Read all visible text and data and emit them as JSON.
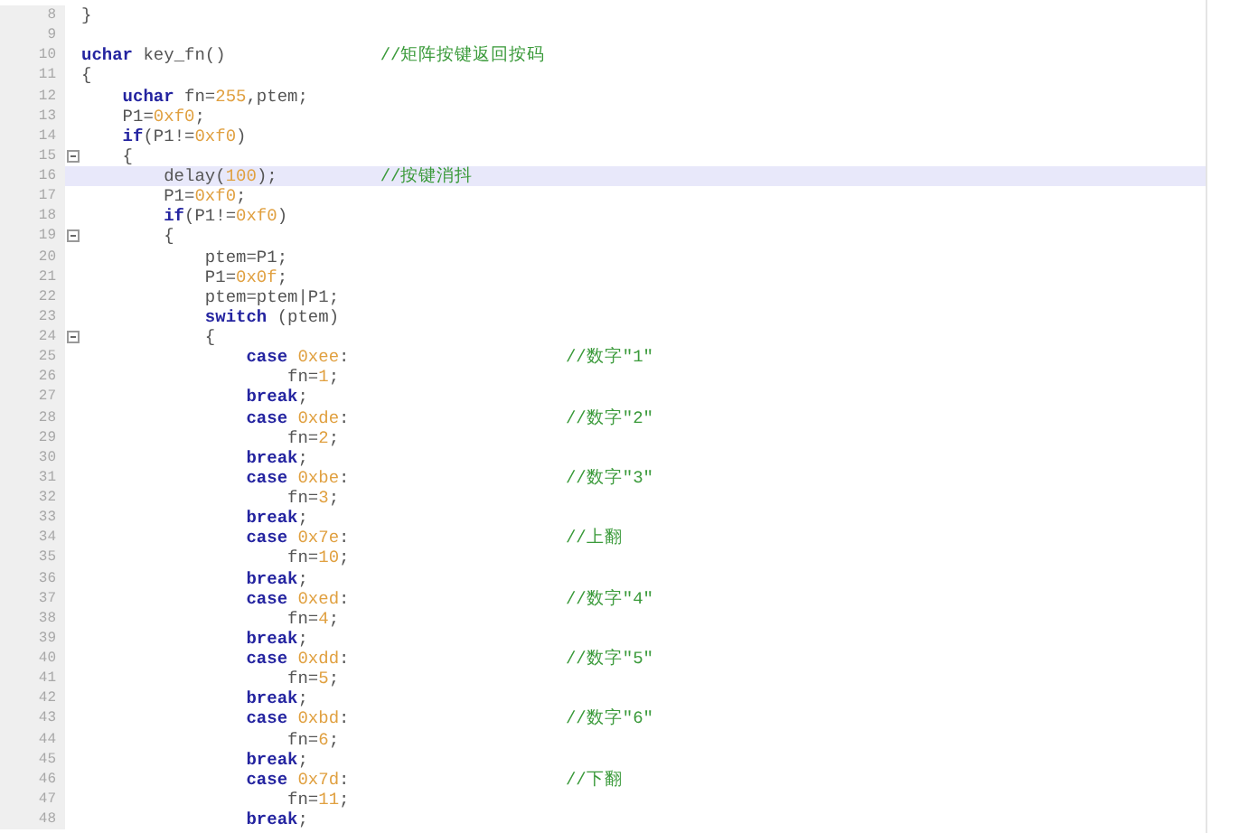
{
  "editor": {
    "lines": [
      {
        "number": "8",
        "tokens": [
          {
            "kind": "plain",
            "text": "}"
          }
        ]
      },
      {
        "number": "9"
      },
      {
        "number": "10",
        "tokens": [
          {
            "kind": "keyword",
            "text": "uchar"
          },
          {
            "kind": "plain",
            "text": " key_fn()"
          }
        ],
        "comment": {
          "kind": "inline",
          "text": "//矩阵按键返回按码"
        }
      },
      {
        "number": "11",
        "tokens": [
          {
            "kind": "plain",
            "text": "{"
          }
        ]
      },
      {
        "number": "12",
        "tokens": [
          {
            "kind": "keyword",
            "text": "    uchar"
          },
          {
            "kind": "plain",
            "text": " fn="
          },
          {
            "kind": "number",
            "text": "255"
          },
          {
            "kind": "plain",
            "text": ",ptem;"
          }
        ]
      },
      {
        "number": "13",
        "tokens": [
          {
            "kind": "plain",
            "text": "    P1="
          },
          {
            "kind": "number",
            "text": "0xf0"
          },
          {
            "kind": "plain",
            "text": ";"
          }
        ]
      },
      {
        "number": "14",
        "tokens": [
          {
            "kind": "keyword",
            "text": "    if"
          },
          {
            "kind": "plain",
            "text": "(P1!="
          },
          {
            "kind": "number",
            "text": "0xf0"
          },
          {
            "kind": "plain",
            "text": ")"
          }
        ]
      },
      {
        "number": "15",
        "fold": true,
        "tokens": [
          {
            "kind": "plain",
            "text": "    {"
          }
        ]
      },
      {
        "number": "16",
        "highlighted": true,
        "tokens": [
          {
            "kind": "plain",
            "text": "        delay("
          },
          {
            "kind": "number",
            "text": "100"
          },
          {
            "kind": "plain",
            "text": ");"
          }
        ],
        "comment": {
          "kind": "inline",
          "text": "//按键消抖"
        }
      },
      {
        "number": "17",
        "tokens": [
          {
            "kind": "plain",
            "text": "        P1="
          },
          {
            "kind": "number",
            "text": "0xf0"
          },
          {
            "kind": "plain",
            "text": ";"
          }
        ]
      },
      {
        "number": "18",
        "tokens": [
          {
            "kind": "keyword",
            "text": "        if"
          },
          {
            "kind": "plain",
            "text": "(P1!="
          },
          {
            "kind": "number",
            "text": "0xf0"
          },
          {
            "kind": "plain",
            "text": ")"
          }
        ]
      },
      {
        "number": "19",
        "fold": true,
        "tokens": [
          {
            "kind": "plain",
            "text": "        {"
          }
        ]
      },
      {
        "number": "20",
        "tokens": [
          {
            "kind": "plain",
            "text": "            ptem=P1;"
          }
        ]
      },
      {
        "number": "21",
        "tokens": [
          {
            "kind": "plain",
            "text": "            P1="
          },
          {
            "kind": "number",
            "text": "0x0f"
          },
          {
            "kind": "plain",
            "text": ";"
          }
        ]
      },
      {
        "number": "22",
        "tokens": [
          {
            "kind": "plain",
            "text": "            ptem=ptem|P1;"
          }
        ]
      },
      {
        "number": "23",
        "tokens": [
          {
            "kind": "keyword",
            "text": "            switch"
          },
          {
            "kind": "plain",
            "text": " (ptem)"
          }
        ]
      },
      {
        "number": "24",
        "fold": true,
        "tokens": [
          {
            "kind": "plain",
            "text": "            {"
          }
        ]
      },
      {
        "number": "25",
        "tokens": [
          {
            "kind": "keyword",
            "text": "                case"
          },
          {
            "kind": "number",
            "text": " 0xee"
          },
          {
            "kind": "plain",
            "text": ":"
          }
        ],
        "comment": {
          "kind": "tabbed",
          "text": "//数字\"1\""
        }
      },
      {
        "number": "26",
        "tokens": [
          {
            "kind": "plain",
            "text": "                    fn="
          },
          {
            "kind": "number",
            "text": "1"
          },
          {
            "kind": "plain",
            "text": ";"
          }
        ]
      },
      {
        "number": "27",
        "tokens": [
          {
            "kind": "keyword",
            "text": "                break"
          },
          {
            "kind": "plain",
            "text": ";"
          }
        ]
      },
      {
        "number": "28",
        "tokens": [
          {
            "kind": "keyword",
            "text": "                case"
          },
          {
            "kind": "number",
            "text": " 0xde"
          },
          {
            "kind": "plain",
            "text": ":"
          }
        ],
        "comment": {
          "kind": "tabbed",
          "text": "//数字\"2\""
        }
      },
      {
        "number": "29",
        "tokens": [
          {
            "kind": "plain",
            "text": "                    fn="
          },
          {
            "kind": "number",
            "text": "2"
          },
          {
            "kind": "plain",
            "text": ";"
          }
        ]
      },
      {
        "number": "30",
        "tokens": [
          {
            "kind": "keyword",
            "text": "                break"
          },
          {
            "kind": "plain",
            "text": ";"
          }
        ]
      },
      {
        "number": "31",
        "tokens": [
          {
            "kind": "keyword",
            "text": "                case"
          },
          {
            "kind": "number",
            "text": " 0xbe"
          },
          {
            "kind": "plain",
            "text": ":"
          }
        ],
        "comment": {
          "kind": "tabbed",
          "text": "//数字\"3\""
        }
      },
      {
        "number": "32",
        "tokens": [
          {
            "kind": "plain",
            "text": "                    fn="
          },
          {
            "kind": "number",
            "text": "3"
          },
          {
            "kind": "plain",
            "text": ";"
          }
        ]
      },
      {
        "number": "33",
        "tokens": [
          {
            "kind": "keyword",
            "text": "                break"
          },
          {
            "kind": "plain",
            "text": ";"
          }
        ]
      },
      {
        "number": "34",
        "tokens": [
          {
            "kind": "keyword",
            "text": "                case"
          },
          {
            "kind": "number",
            "text": " 0x7e"
          },
          {
            "kind": "plain",
            "text": ":"
          }
        ],
        "comment": {
          "kind": "tabbed",
          "text": "//上翻"
        }
      },
      {
        "number": "35",
        "tokens": [
          {
            "kind": "plain",
            "text": "                    fn="
          },
          {
            "kind": "number",
            "text": "10"
          },
          {
            "kind": "plain",
            "text": ";"
          }
        ]
      },
      {
        "number": "36",
        "tokens": [
          {
            "kind": "keyword",
            "text": "                break"
          },
          {
            "kind": "plain",
            "text": ";"
          }
        ]
      },
      {
        "number": "37",
        "tokens": [
          {
            "kind": "keyword",
            "text": "                case"
          },
          {
            "kind": "number",
            "text": " 0xed"
          },
          {
            "kind": "plain",
            "text": ":"
          }
        ],
        "comment": {
          "kind": "tabbed",
          "text": "//数字\"4\""
        }
      },
      {
        "number": "38",
        "tokens": [
          {
            "kind": "plain",
            "text": "                    fn="
          },
          {
            "kind": "number",
            "text": "4"
          },
          {
            "kind": "plain",
            "text": ";"
          }
        ]
      },
      {
        "number": "39",
        "tokens": [
          {
            "kind": "keyword",
            "text": "                break"
          },
          {
            "kind": "plain",
            "text": ";"
          }
        ]
      },
      {
        "number": "40",
        "tokens": [
          {
            "kind": "keyword",
            "text": "                case"
          },
          {
            "kind": "number",
            "text": " 0xdd"
          },
          {
            "kind": "plain",
            "text": ":"
          }
        ],
        "comment": {
          "kind": "tabbed",
          "text": "//数字\"5\""
        }
      },
      {
        "number": "41",
        "tokens": [
          {
            "kind": "plain",
            "text": "                    fn="
          },
          {
            "kind": "number",
            "text": "5"
          },
          {
            "kind": "plain",
            "text": ";"
          }
        ]
      },
      {
        "number": "42",
        "tokens": [
          {
            "kind": "keyword",
            "text": "                break"
          },
          {
            "kind": "plain",
            "text": ";"
          }
        ]
      },
      {
        "number": "43",
        "tokens": [
          {
            "kind": "keyword",
            "text": "                case"
          },
          {
            "kind": "number",
            "text": " 0xbd"
          },
          {
            "kind": "plain",
            "text": ":"
          }
        ],
        "comment": {
          "kind": "tabbed",
          "text": "//数字\"6\""
        }
      },
      {
        "number": "44",
        "tokens": [
          {
            "kind": "plain",
            "text": "                    fn="
          },
          {
            "kind": "number",
            "text": "6"
          },
          {
            "kind": "plain",
            "text": ";"
          }
        ]
      },
      {
        "number": "45",
        "tokens": [
          {
            "kind": "keyword",
            "text": "                break"
          },
          {
            "kind": "plain",
            "text": ";"
          }
        ]
      },
      {
        "number": "46",
        "tokens": [
          {
            "kind": "keyword",
            "text": "                case"
          },
          {
            "kind": "number",
            "text": " 0x7d"
          },
          {
            "kind": "plain",
            "text": ":"
          }
        ],
        "comment": {
          "kind": "tabbed",
          "text": "//下翻"
        }
      },
      {
        "number": "47",
        "tokens": [
          {
            "kind": "plain",
            "text": "                    fn="
          },
          {
            "kind": "number",
            "text": "11"
          },
          {
            "kind": "plain",
            "text": ";"
          }
        ]
      },
      {
        "number": "48",
        "tokens": [
          {
            "kind": "keyword",
            "text": "                break"
          },
          {
            "kind": "plain",
            "text": ";"
          }
        ]
      }
    ]
  }
}
